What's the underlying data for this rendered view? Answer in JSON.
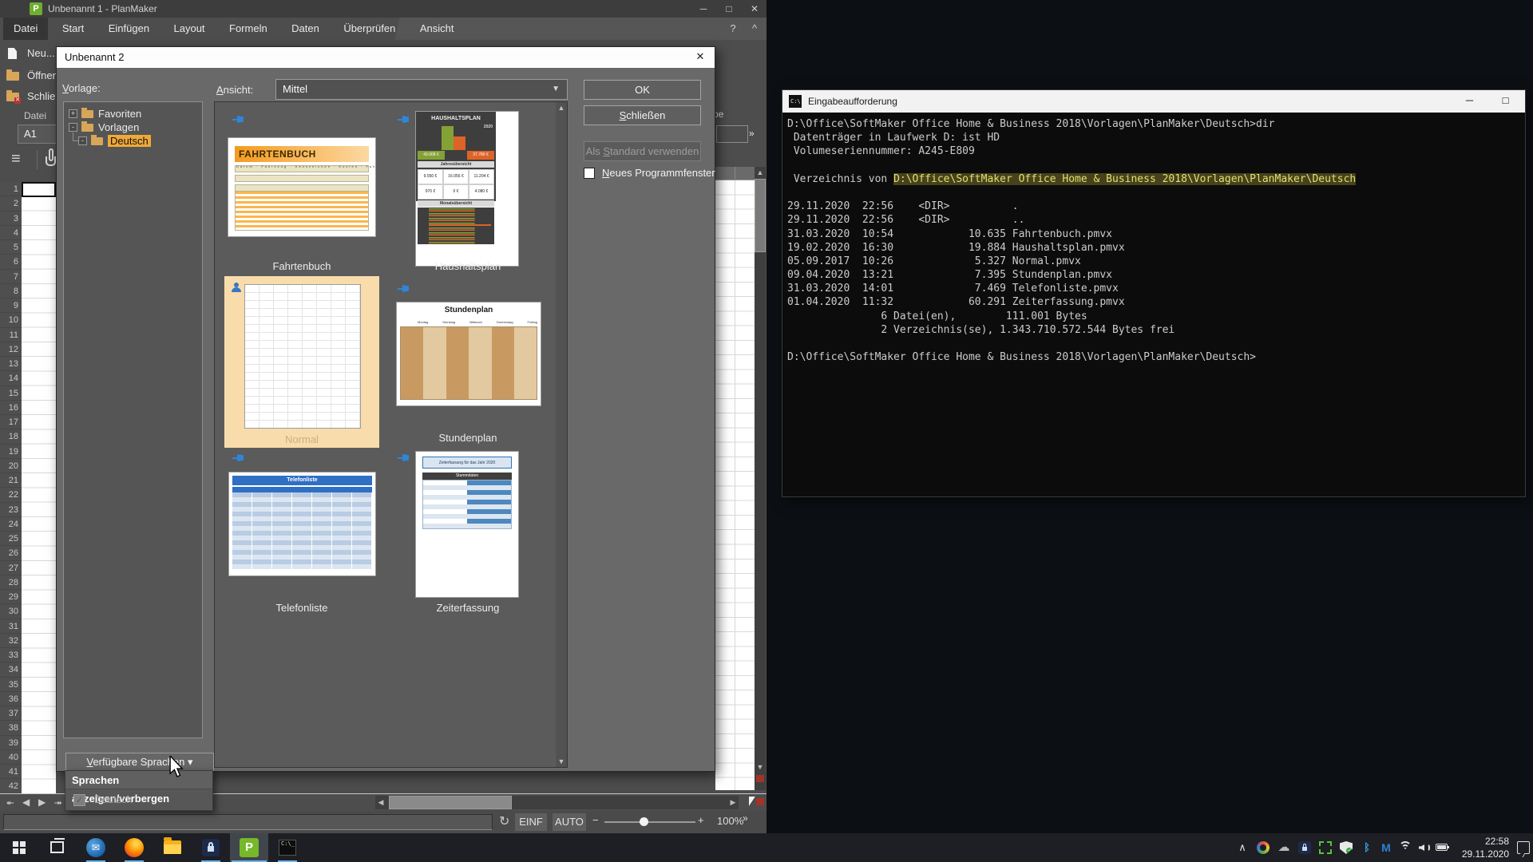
{
  "planmaker": {
    "title": "Unbenannt 1 - PlanMaker",
    "app_badge": "P",
    "window_buttons": {
      "minimize": "─",
      "maximize": "□",
      "close": "✕"
    },
    "menus": [
      "Datei",
      "Start",
      "Einfügen",
      "Layout",
      "Formeln",
      "Daten",
      "Überprüfen",
      "Ansicht"
    ],
    "menu_help": "?",
    "menu_collapse": "^",
    "file_menu": [
      "Neu...",
      "Öffnen",
      "Schließen"
    ],
    "group_label": "Datei",
    "group_label_fragment": "pe",
    "overflow_chevron": "»",
    "name_box": "A1",
    "row_count": 42,
    "statusbar": {
      "sync": "↻",
      "insert_mode": "EINF",
      "auto": "AUTO",
      "zoom_minus": "−",
      "zoom_plus": "+",
      "zoom_level": "100%",
      "more": "»"
    }
  },
  "dialog": {
    "title": "Unbenannt 2",
    "close_glyph": "✕",
    "vorlage_label": {
      "u": "V",
      "rest": "orlage:"
    },
    "ansicht_label": {
      "u": "A",
      "rest": "nsicht:"
    },
    "ansicht_value": "Mittel",
    "tree": [
      {
        "expander": "+",
        "label": "Favoriten",
        "selected": false
      },
      {
        "expander": "-",
        "label": "Vorlagen",
        "selected": false
      },
      {
        "expander": "-",
        "label": "Deutsch",
        "selected": true
      }
    ],
    "templates": {
      "labels": [
        "Fahrtenbuch",
        "Haushaltsplan",
        "Normal",
        "Stundenplan",
        "Telefonliste",
        "Zeiterfassung"
      ],
      "selected": "Normal",
      "fahrtenbuch": {
        "title": "FAHRTENBUCH",
        "fields": "Datum · Fahrzeug · Kennzeichen · Kosten · Fahrer"
      },
      "haushaltsplan": {
        "title": "HAUSHALTSPLAN",
        "year": "2020",
        "income": "43.008 €",
        "expense": "37.780 €",
        "band1": "Jahresübersicht",
        "cells": [
          "9.550 €",
          "16.056 €",
          "11.204 €",
          "970 €",
          "0 €",
          "4.080 €"
        ],
        "band2": "Monatsübersicht"
      },
      "stundenplan": {
        "title": "Stundenplan",
        "days": [
          "Montag",
          "Dienstag",
          "Mittwoch",
          "Donnerstag",
          "Freitag"
        ]
      },
      "telefonliste": {
        "title": "Telefonliste"
      },
      "zeiterfassung": {
        "title": "Zeiterfassung für das Jahr 2020",
        "band": "Stammdaten"
      }
    },
    "buttons": {
      "ok": "OK",
      "close": {
        "u": "S",
        "rest": "chließen"
      },
      "set_default": {
        "pre": "Als ",
        "u": "S",
        "rest": "tandard verwenden"
      }
    },
    "checkbox": {
      "u": "N",
      "rest": "eues Programmfenster",
      "checked": false
    },
    "languages_button": {
      "u": "V",
      "rest": "erfügbare Sprachen",
      "caret": "▾"
    },
    "languages_menu": {
      "header": "Sprachen anzeigen/verbergen",
      "item_label": "Deutsch",
      "item_checked": "✓"
    }
  },
  "cmd": {
    "title": "Eingabeaufforderung",
    "buttons": {
      "minimize": "─",
      "maximize": "□"
    },
    "lines": [
      "D:\\Office\\SoftMaker Office Home & Business 2018\\Vorlagen\\PlanMaker\\Deutsch>dir",
      " Datenträger in Laufwerk D: ist HD",
      " Volumeseriennummer: A245-E809",
      "",
      {
        "text": " Verzeichnis von ",
        "hl": "D:\\Office\\SoftMaker Office Home & Business 2018\\Vorlagen\\PlanMaker\\Deutsch"
      },
      "",
      "29.11.2020  22:56    <DIR>          .",
      "29.11.2020  22:56    <DIR>          ..",
      "31.03.2020  10:54            10.635 Fahrtenbuch.pmvx",
      "19.02.2020  16:30            19.884 Haushaltsplan.pmvx",
      "05.09.2017  10:26             5.327 Normal.pmvx",
      "09.04.2020  13:21             7.395 Stundenplan.pmvx",
      "31.03.2020  14:01             7.469 Telefonliste.pmvx",
      "01.04.2020  11:32            60.291 Zeiterfassung.pmvx",
      "               6 Datei(en),        111.001 Bytes",
      "               2 Verzeichnis(se), 1.343.710.572.544 Bytes frei",
      "",
      "D:\\Office\\SoftMaker Office Home & Business 2018\\Vorlagen\\PlanMaker\\Deutsch>"
    ]
  },
  "taskbar": {
    "planmaker_badge": "P",
    "cmd_badge": "C:\\_",
    "clock": {
      "time": "22:58",
      "date": "29.11.2020"
    }
  }
}
